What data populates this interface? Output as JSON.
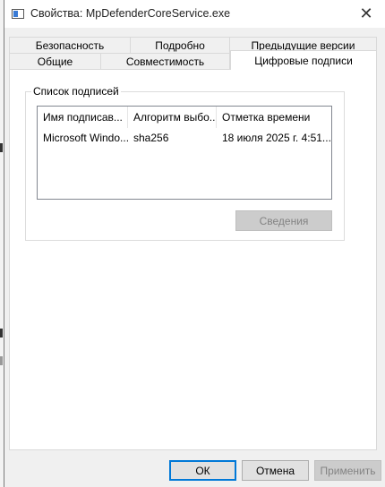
{
  "window": {
    "title": "Свойства: MpDefenderCoreService.exe"
  },
  "tabs": {
    "row1": [
      {
        "label": "Безопасность"
      },
      {
        "label": "Подробно"
      },
      {
        "label": "Предыдущие версии"
      }
    ],
    "row2": [
      {
        "label": "Общие"
      },
      {
        "label": "Совместимость"
      },
      {
        "label": "Цифровые подписи",
        "active": true
      }
    ]
  },
  "signatures": {
    "group_label": "Список подписей",
    "columns": [
      "Имя подписав...",
      "Алгоритм выбо...",
      "Отметка времени"
    ],
    "rows": [
      [
        "Microsoft Windo...",
        "sha256",
        "18 июля 2025 г. 4:51..."
      ]
    ],
    "details_button": "Сведения"
  },
  "footer": {
    "ok": "ОК",
    "cancel": "Отмена",
    "apply": "Применить"
  },
  "icons": {
    "title": "file-properties-icon",
    "close": "close-icon"
  }
}
